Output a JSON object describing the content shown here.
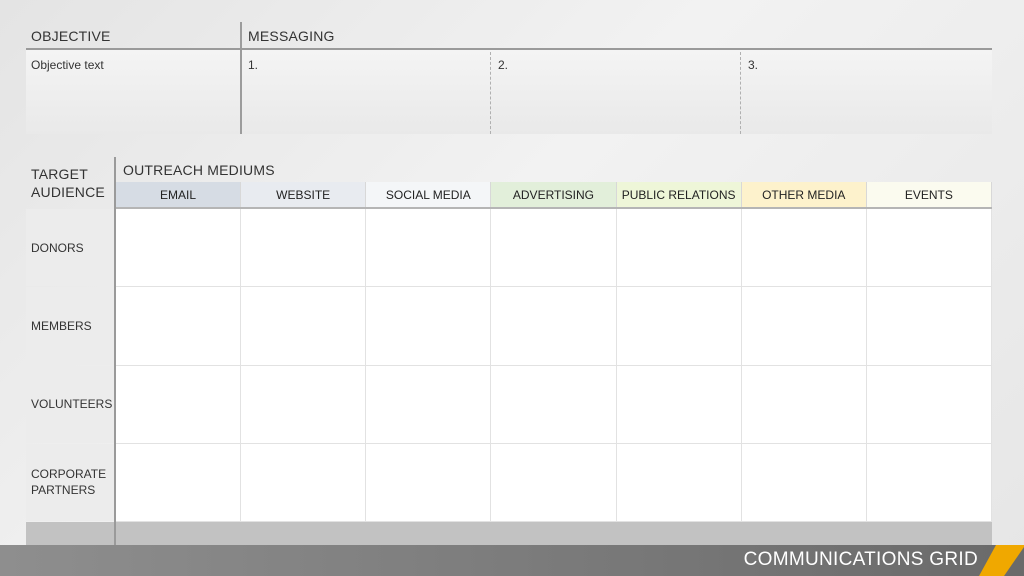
{
  "top": {
    "objective_header": "OBJECTIVE",
    "messaging_header": "MESSAGING",
    "objective_text": "Objective text",
    "messages": [
      "1.",
      "2.",
      "3."
    ]
  },
  "grid": {
    "target_header_line1": "TARGET",
    "target_header_line2": "AUDIENCE",
    "outreach_header": "OUTREACH MEDIUMS",
    "mediums": [
      {
        "label": "EMAIL",
        "color": "#d6dce4"
      },
      {
        "label": "WEBSITE",
        "color": "#e8ebf0"
      },
      {
        "label": "SOCIAL MEDIA",
        "color": "#f4f6f8"
      },
      {
        "label": "ADVERTISING",
        "color": "#e2efda"
      },
      {
        "label": "PUBLIC RELATIONS",
        "color": "#eef6d8"
      },
      {
        "label": "OTHER MEDIA",
        "color": "#fdf2cc"
      },
      {
        "label": "EVENTS",
        "color": "#fbfbef"
      }
    ],
    "audiences": [
      {
        "line1": "DONORS",
        "line2": ""
      },
      {
        "line1": "MEMBERS",
        "line2": ""
      },
      {
        "line1": "VOLUNTEERS",
        "line2": ""
      },
      {
        "line1": "CORPORATE",
        "line2": "PARTNERS"
      }
    ]
  },
  "footer": {
    "title": "COMMUNICATIONS GRID",
    "accent_color": "#f0a800"
  }
}
